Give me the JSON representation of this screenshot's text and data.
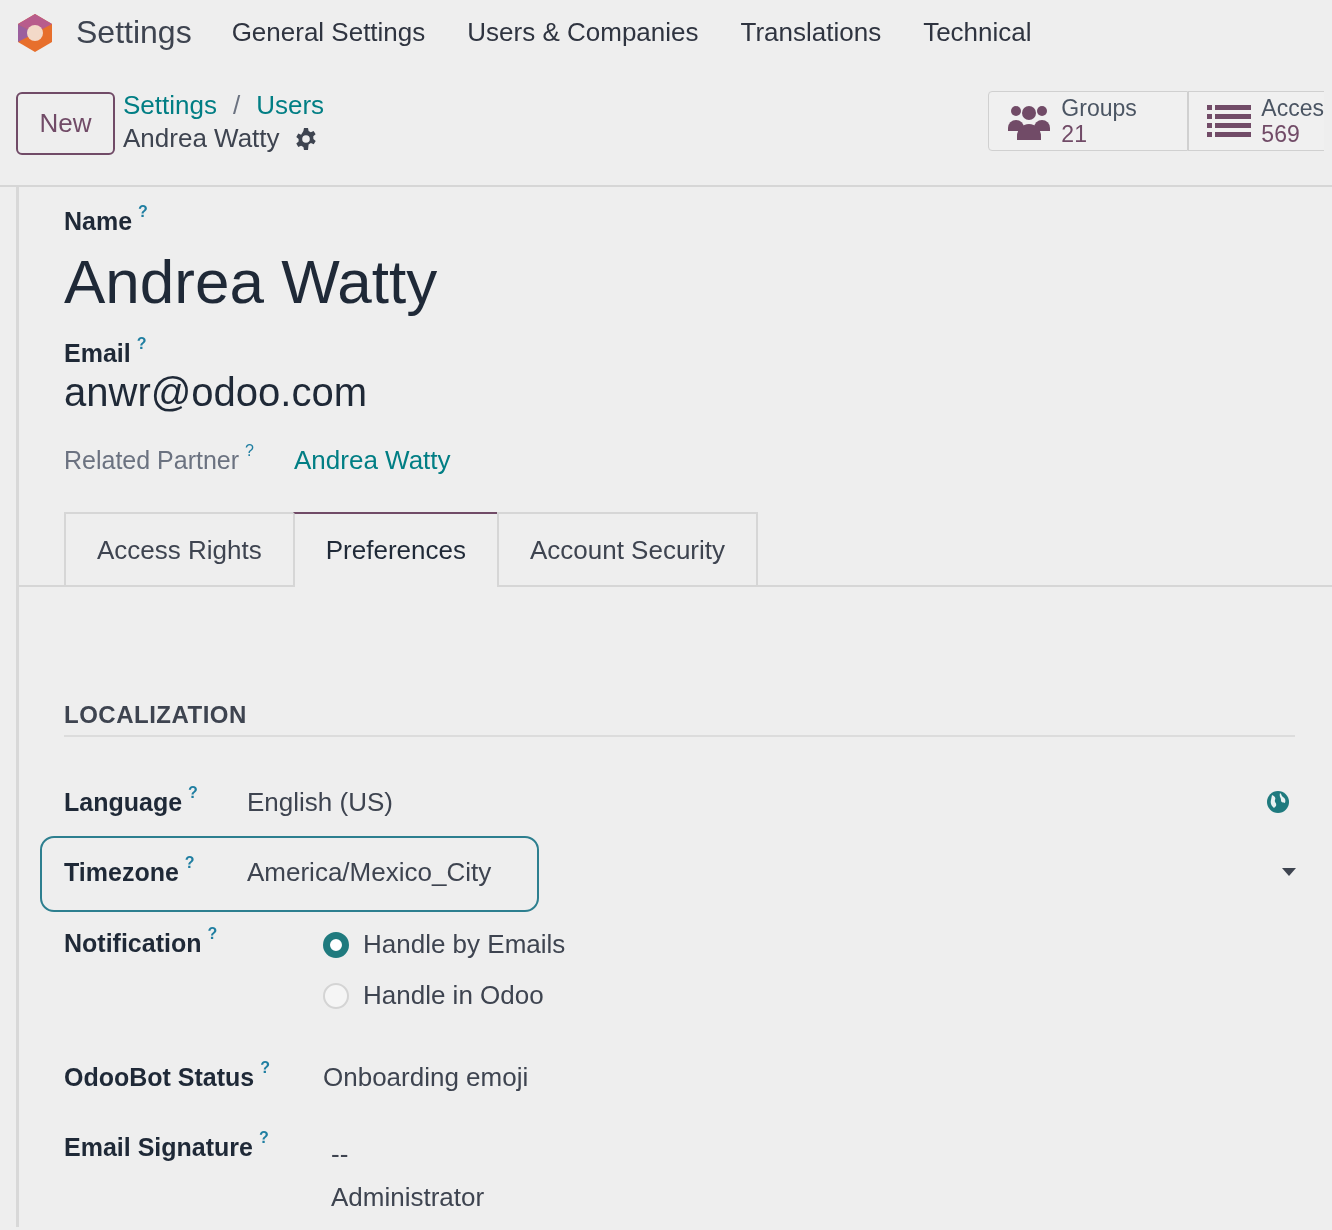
{
  "app": {
    "name": "Settings"
  },
  "menu": [
    {
      "label": "General Settings"
    },
    {
      "label": "Users & Companies"
    },
    {
      "label": "Translations"
    },
    {
      "label": "Technical"
    }
  ],
  "control_panel": {
    "new_button": "New",
    "breadcrumbs": [
      {
        "label": "Settings"
      },
      {
        "label": "Users"
      }
    ],
    "separator": "/",
    "record_name": "Andrea Watty"
  },
  "stat_buttons": [
    {
      "kind": "groups",
      "label": "Groups",
      "value": "21"
    },
    {
      "kind": "list",
      "label": "Acces",
      "value": "569"
    }
  ],
  "name": {
    "label": "Name",
    "help": "?",
    "value": "Andrea Watty"
  },
  "email": {
    "label": "Email",
    "help": "?",
    "value": "anwr@odoo.com"
  },
  "related_partner": {
    "label": "Related Partner",
    "help": "?",
    "value": "Andrea Watty"
  },
  "tabs": [
    {
      "label": "Access Rights",
      "selected": false
    },
    {
      "label": "Preferences",
      "selected": true
    },
    {
      "label": "Account Security",
      "selected": false
    }
  ],
  "section": {
    "title": "LOCALIZATION"
  },
  "fields": [
    {
      "kind": "translatable",
      "label": "Language",
      "help": "?",
      "value": "English (US)"
    },
    {
      "kind": "select",
      "label": "Timezone",
      "help": "?",
      "value": "America/Mexico_City",
      "highlighted": true
    },
    {
      "kind": "radio",
      "label": "Notification",
      "help": "?",
      "options": [
        {
          "label": "Handle by Emails",
          "selected": true
        },
        {
          "label": "Handle in Odoo",
          "selected": false
        }
      ]
    },
    {
      "kind": "text",
      "label": "OdooBot Status",
      "help": "?",
      "value": "Onboarding emoji"
    },
    {
      "kind": "multiline",
      "label": "Email Signature",
      "help": "?",
      "lines": [
        "--",
        "Administrator"
      ]
    }
  ]
}
